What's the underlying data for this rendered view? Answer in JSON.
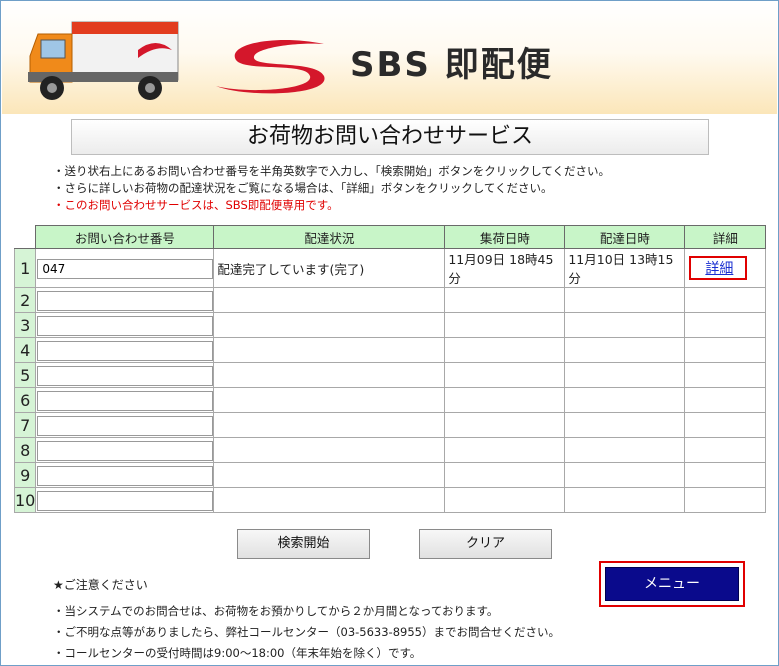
{
  "header": {
    "brand": "SBS 即配便"
  },
  "title": "お荷物お問い合わせサービス",
  "notes": [
    "・送り状右上にあるお問い合わせ番号を半角英数字で入力し、「検索開始」ボタンをクリックしてください。",
    "・さらに詳しいお荷物の配達状況をご覧になる場合は、「詳細」ボタンをクリックしてください。"
  ],
  "note_red": "・このお問い合わせサービスは、SBS即配便専用です。",
  "table": {
    "headers": [
      "お問い合わせ番号",
      "配達状況",
      "集荷日時",
      "配達日時",
      "詳細"
    ],
    "rows": [
      {
        "num": "1",
        "code": "047",
        "status": "配達完了しています(完了)",
        "pickup": "11月09日 18時45分",
        "delivery": "11月10日 13時15分",
        "detail": "詳細"
      },
      {
        "num": "2"
      },
      {
        "num": "3"
      },
      {
        "num": "4"
      },
      {
        "num": "5"
      },
      {
        "num": "6"
      },
      {
        "num": "7"
      },
      {
        "num": "8"
      },
      {
        "num": "9"
      },
      {
        "num": "10"
      }
    ]
  },
  "buttons": {
    "search": "検索開始",
    "clear": "クリア",
    "menu": "メニュー"
  },
  "caution_title": "★ご注意ください",
  "footer_notes": [
    "・当システムでのお問合せは、お荷物をお預かりしてから２か月間となっております。",
    "・ご不明な点等がありましたら、弊社コールセンター（03-5633-8955）までお問合せください。",
    "・コールセンターの受付時間は9:00～18:00（年末年始を除く）です。"
  ],
  "colors": {
    "accent_red": "#e00000",
    "menu_blue": "#0a0a8c",
    "header_green": "#c8f5c8"
  }
}
